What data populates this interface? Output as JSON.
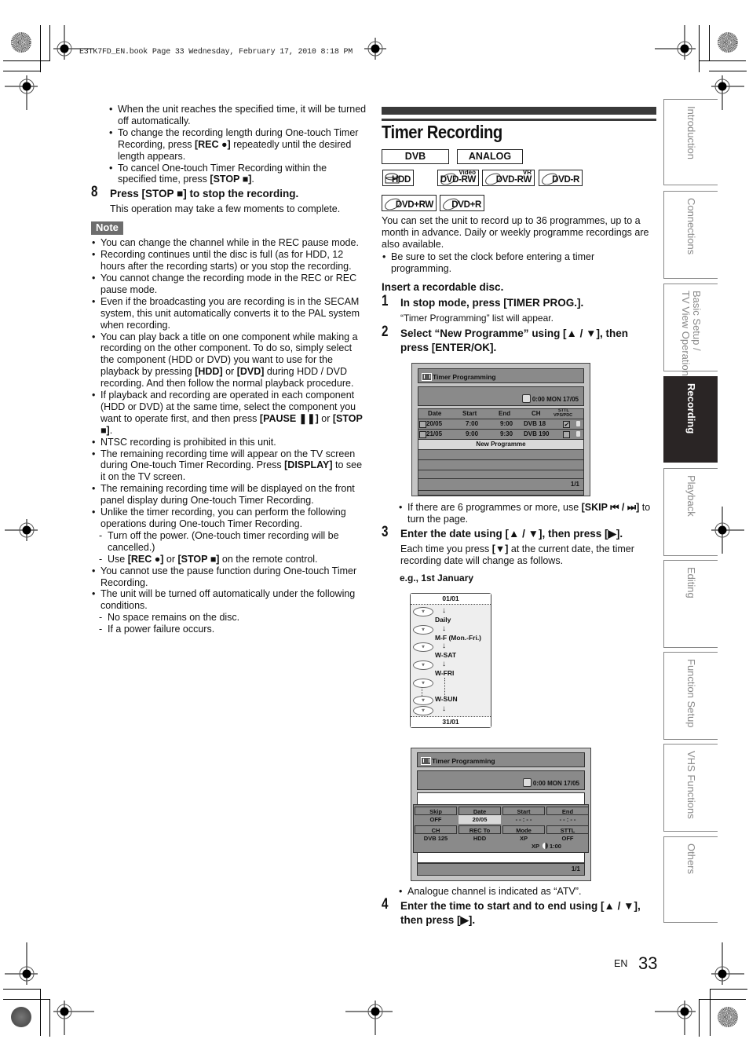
{
  "print_header": "E3TK7FD_EN.book  Page 33  Wednesday, February 17, 2010  8:18 PM",
  "left_column": {
    "intro_bullets": [
      "When the unit reaches the specified time, it will be turned off automatically.",
      [
        "To change the recording length during One-touch Timer Recording, press ",
        "[REC ●]",
        " repeatedly until the desired length appears."
      ],
      [
        "To cancel One-touch Timer Recording within the specified time, press ",
        "[STOP ■]",
        "."
      ]
    ],
    "step8": {
      "number": "8",
      "title": "Press [STOP ■] to stop the recording.",
      "desc": "This operation may take a few moments to complete."
    },
    "note_label": "Note",
    "notes": [
      {
        "text": "You can change the channel while in the REC pause mode."
      },
      {
        "text": "Recording continues until the disc is full (as for HDD, 12 hours after the recording starts) or you stop the recording."
      },
      {
        "text": "You cannot change the recording mode in the REC or REC pause mode."
      },
      {
        "text": "Even if the broadcasting you are recording is in the SECAM system, this unit automatically converts it to the PAL system when recording."
      },
      {
        "parts": [
          "You can play back a title on one component while making a recording on the other component. To do so, simply select the component (HDD or DVD) you want to use for the playback by pressing ",
          "[HDD]",
          " or ",
          "[DVD]",
          " during HDD / DVD recording. And then follow the normal playback procedure."
        ]
      },
      {
        "parts": [
          "If playback and recording are operated in each component (HDD or DVD) at the same time, select the component you want to operate first, and then press ",
          "[PAUSE ❚❚]",
          " or ",
          "[STOP ■]",
          "."
        ]
      },
      {
        "text": "NTSC recording is prohibited in this unit."
      },
      {
        "parts": [
          "The remaining recording time will appear on the TV screen during One-touch Timer Recording. Press ",
          "[DISPLAY]",
          " to see it on the TV screen."
        ]
      },
      {
        "text": "The remaining recording time will be displayed on the front panel display during One-touch Timer Recording."
      },
      {
        "text": "Unlike the timer recording, you can perform the following operations during One-touch Timer Recording."
      },
      {
        "sub": true,
        "text": "Turn off the power. (One-touch timer recording will be cancelled.)"
      },
      {
        "sub": true,
        "parts": [
          "Use ",
          "[REC ●]",
          " or ",
          "[STOP ■]",
          " on the remote control."
        ]
      },
      {
        "text": "You cannot use the pause function during One-touch Timer Recording."
      },
      {
        "text": "The unit will be turned off automatically under the following conditions."
      },
      {
        "sub": true,
        "text": "No space remains on the disc."
      },
      {
        "sub": true,
        "text": "If a power failure occurs."
      }
    ]
  },
  "section": {
    "title": "Timer Recording",
    "tags": [
      "DVB",
      "ANALOG"
    ],
    "discs": [
      {
        "label": "HDD",
        "sup": ""
      },
      {
        "label": "DVD-RW",
        "sup": "Video"
      },
      {
        "label": "DVD-RW",
        "sup": "VR"
      },
      {
        "label": "DVD-R",
        "sup": ""
      },
      {
        "label": "DVD+RW",
        "sup": ""
      },
      {
        "label": "DVD+R",
        "sup": ""
      }
    ],
    "intro": "You can set the unit to record up to 36 programmes, up to a month in advance. Daily or weekly programme recordings are also available.",
    "intro_bullet": "Be sure to set the clock before entering a timer programming.",
    "insert": "Insert a recordable disc.",
    "step1": {
      "number": "1",
      "title": "In stop mode, press [TIMER PROG.].",
      "desc": "“Timer Programming” list will appear."
    },
    "step2": {
      "number": "2",
      "title": "Select “New Programme” using [▲ / ▼], then press [ENTER/OK]."
    },
    "screen1": {
      "title": "Timer Programming",
      "clock": "0:00 MON 17/05",
      "headers": [
        "Date",
        "Start",
        "End",
        "CH",
        "STTL",
        "VPS/PDC"
      ],
      "rows": [
        {
          "date": "20/05",
          "start": "7:00",
          "end": "9:00",
          "ch": "DVB 18",
          "vps": true
        },
        {
          "date": "21/05",
          "start": "9:00",
          "end": "9:30",
          "ch": "DVB 190",
          "vps": false
        }
      ],
      "new_programme": "New Programme",
      "page": "1/1"
    },
    "skip_bullet": [
      "If there are 6 programmes or more, use ",
      "[SKIP ⏮ / ⏭]",
      " to turn the page."
    ],
    "step3": {
      "number": "3",
      "title": "Enter the date using [▲ / ▼], then press [▶].",
      "desc": [
        "Each time you press ",
        "[▼]",
        " at the current date, the timer recording date will change as follows."
      ]
    },
    "example": "e.g., 1st January",
    "date_sequence": {
      "top": "01/01",
      "items": [
        "Daily",
        "M-F (Mon.-Fri.)",
        "W-SAT",
        "W-FRI",
        "W-SUN"
      ],
      "bottom": "31/01"
    },
    "screen2": {
      "title": "Timer Programming",
      "clock": "0:00 MON 17/05",
      "row1_headers": [
        "Skip",
        "Date",
        "Start",
        "End"
      ],
      "row1_values": [
        "OFF",
        "20/05",
        "- - : - -",
        "- - : - -"
      ],
      "row2_headers": [
        "CH",
        "REC To",
        "Mode",
        "STTL"
      ],
      "row2_values": [
        "DVB 125",
        "HDD",
        "XP",
        "OFF"
      ],
      "mode_info": "XP",
      "remaining": "1:00",
      "page": "1/1"
    },
    "atv_bullet": "Analogue channel is indicated as “ATV”.",
    "step4": {
      "number": "4",
      "title": "Enter the time to start and to end using [▲ / ▼], then press [▶]."
    }
  },
  "tabs": [
    {
      "label": "Introduction",
      "active": false
    },
    {
      "label": "Connections",
      "active": false
    },
    {
      "label": "Basic Setup /\nTV View Operation",
      "active": false
    },
    {
      "label": "Recording",
      "active": true
    },
    {
      "label": "Playback",
      "active": false
    },
    {
      "label": "Editing",
      "active": false
    },
    {
      "label": "Function Setup",
      "active": false
    },
    {
      "label": "VHS Functions",
      "active": false
    },
    {
      "label": "Others",
      "active": false
    }
  ],
  "footer": {
    "lang": "EN",
    "page": "33"
  }
}
